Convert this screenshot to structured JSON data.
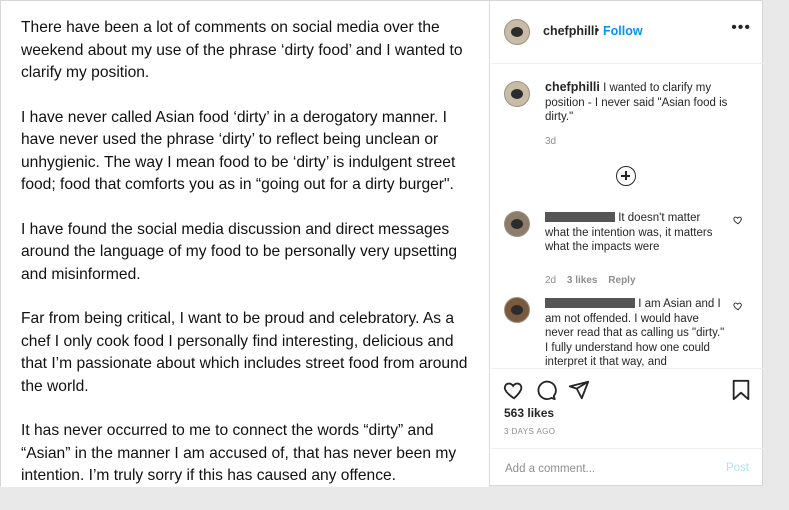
{
  "post": {
    "paragraphs": [
      "There have been a lot of comments on social media over the weekend about my use of the phrase ‘dirty food’ and I wanted to clarify my position.",
      "I have never called Asian food ‘dirty’ in a derogatory manner. I have never used the phrase ‘dirty’ to reflect being unclean or unhygienic. The way I mean food to be ‘dirty’ is indulgent street food; food that comforts you as in “going out for a dirty burger\".",
      "I have found the social media discussion and direct messages around the language of my food to be personally very upsetting and misinformed.",
      "Far from being critical, I want to be proud and celebratory. As a chef I only cook food I personally find interesting, delicious and that I’m passionate about which includes street food from around the world.",
      "It has never occurred to me to connect the words “dirty” and “Asian” in the manner I am accused of, that has never been my intention. I’m truly sorry if this has caused any offence."
    ]
  },
  "header": {
    "username": "chefphilli",
    "dot": "•",
    "follow_label": "Follow",
    "more_label": "•••"
  },
  "caption": {
    "username": "chefphilli",
    "text": "I wanted to clarify my position - I never said \"Asian food is dirty.\"",
    "time": "3d"
  },
  "comments": [
    {
      "text": "It doesn't matter what the intention was, it matters what the impacts were",
      "time": "2d",
      "likes": "3 likes",
      "reply": "Reply"
    },
    {
      "text": "I am Asian and I am not offended. I would have never read that as calling us \"dirty.\" I fully understand how one could interpret it that way, and"
    }
  ],
  "actions": {
    "likes": "563 likes",
    "days": "3 DAYS AGO"
  },
  "add_comment": {
    "placeholder": "Add a comment...",
    "post_label": "Post"
  },
  "colors": {
    "accent": "#0095f6",
    "post_disabled": "#b2dffc",
    "muted": "#8e8e8e"
  }
}
